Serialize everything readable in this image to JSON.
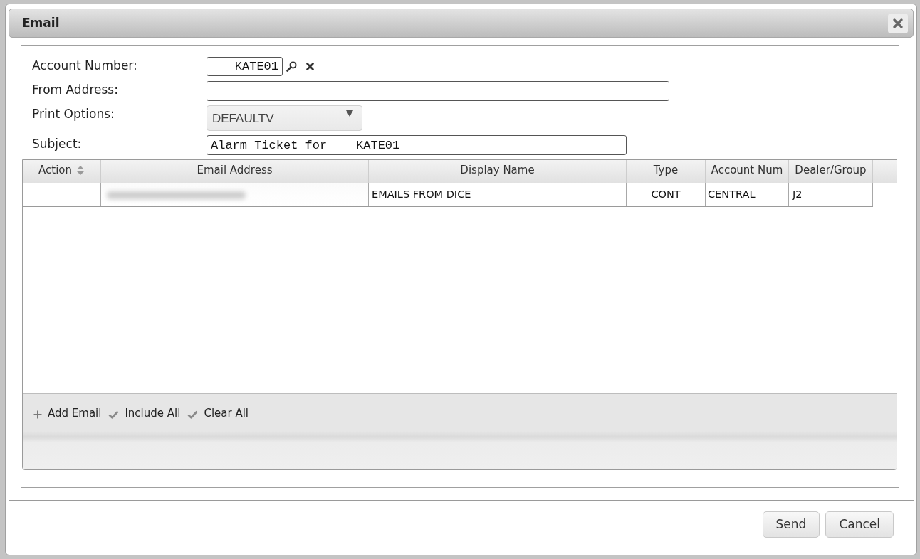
{
  "window": {
    "title": "Email"
  },
  "form": {
    "fields": [
      {
        "kind": "lookup",
        "label": "Account Number:",
        "value": "KATE01"
      },
      {
        "kind": "text",
        "label": "From Address:"
      },
      {
        "kind": "select",
        "label": "Print Options:",
        "value": "DEFAULTV"
      },
      {
        "kind": "text",
        "label": "Subject:",
        "value": "Alarm Ticket for    KATE01"
      }
    ]
  },
  "table": {
    "columns": [
      {
        "label": "Action",
        "sortable": true
      },
      {
        "label": "Email Address",
        "sortable": false
      },
      {
        "label": "Display Name",
        "sortable": false
      },
      {
        "label": "Type",
        "sortable": false
      },
      {
        "label": "Account Num",
        "sortable": false
      },
      {
        "label": "Dealer/Group",
        "sortable": false
      }
    ],
    "rows": [
      {
        "cells": [
          {
            "kind": "empty"
          },
          {
            "kind": "blurred"
          },
          {
            "kind": "text",
            "text": "EMAILS FROM DICE"
          },
          {
            "kind": "text",
            "text": "CONT"
          },
          {
            "kind": "text",
            "text": "CENTRAL"
          },
          {
            "kind": "text",
            "text": "J2"
          }
        ]
      }
    ]
  },
  "toolbar": [
    {
      "kind": "add",
      "label": "Add Email"
    },
    {
      "kind": "check",
      "label": "Include All"
    },
    {
      "kind": "check",
      "label": "Clear All"
    }
  ],
  "buttons": [
    "Send",
    "Cancel"
  ]
}
